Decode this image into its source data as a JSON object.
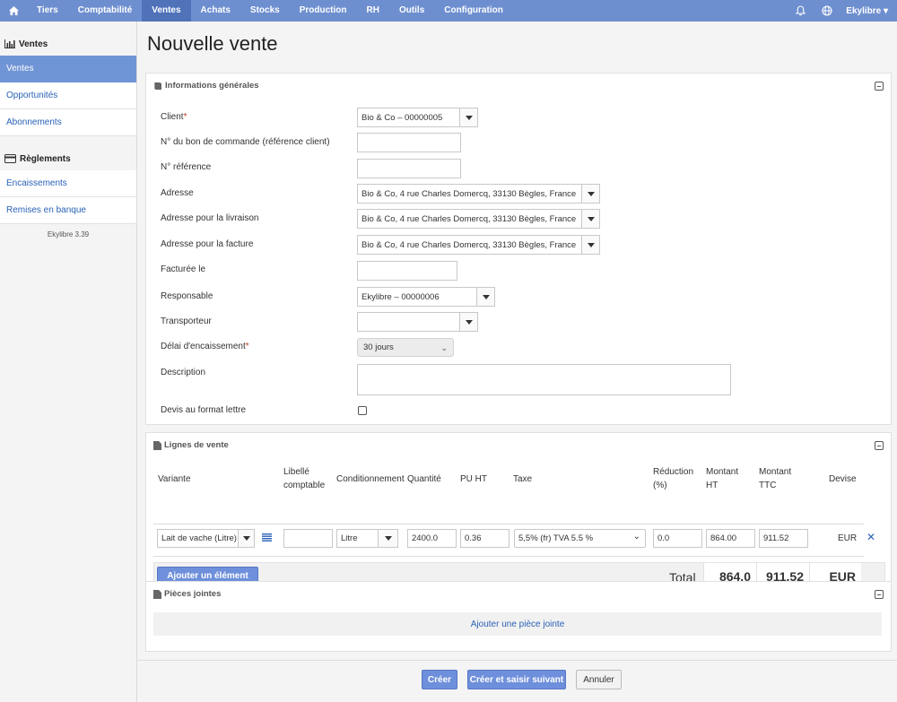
{
  "nav": {
    "items": [
      "Tiers",
      "Comptabilité",
      "Ventes",
      "Achats",
      "Stocks",
      "Production",
      "RH",
      "Outils",
      "Configuration"
    ],
    "active": "Ventes",
    "user": "Ekylibre ▾",
    "icons": [
      "home-icon",
      "bell-icon",
      "globe-icon"
    ]
  },
  "sidebar": {
    "sections": [
      {
        "title": "Ventes",
        "icon": "bar-chart-icon",
        "items": [
          "Ventes",
          "Opportunités",
          "Abonnements"
        ]
      },
      {
        "title": "Règlements",
        "icon": "credit-card-icon",
        "items": [
          "Encaissements",
          "Remises en banque"
        ]
      }
    ],
    "active": "Ventes",
    "version": "Ekylibre 3.39"
  },
  "page": {
    "title": "Nouvelle vente"
  },
  "general": {
    "title": "Informations générales",
    "fields": {
      "client": {
        "label": "Client",
        "value": "Bio & Co – 00000005"
      },
      "po": {
        "label": "N° du bon de commande (référence client)",
        "value": ""
      },
      "ref": {
        "label": "N° référence",
        "value": ""
      },
      "address": {
        "label": "Adresse",
        "value": "Bio & Co, 4 rue Charles Domercq, 33130 Bègles, France"
      },
      "delivery": {
        "label": "Adresse pour la livraison",
        "value": "Bio & Co, 4 rue Charles Domercq, 33130 Bègles, France"
      },
      "invoice_addr": {
        "label": "Adresse pour la facture",
        "value": "Bio & Co, 4 rue Charles Domercq, 33130 Bègles, France"
      },
      "invoiced_at": {
        "label": "Facturée le",
        "value": ""
      },
      "responsible": {
        "label": "Responsable",
        "value": "Ekylibre – 00000006"
      },
      "carrier": {
        "label": "Transporteur",
        "value": ""
      },
      "delay": {
        "label": "Délai d'encaissement",
        "value": "30 jours"
      },
      "description": {
        "label": "Description",
        "value": ""
      },
      "letter": {
        "label": "Devis au format lettre",
        "checked": false
      }
    }
  },
  "lines": {
    "title": "Lignes de vente",
    "headers": {
      "variant": "Variante",
      "label1": "Libellé",
      "label2": "comptable",
      "packaging": "Conditionnement",
      "qty": "Quantité",
      "pu": "PU HT",
      "tax": "Taxe",
      "red1": "Réduction",
      "red2": "(%)",
      "ht1": "Montant",
      "ht2": "HT",
      "ttc1": "Montant",
      "ttc2": "TTC",
      "currency": "Devise"
    },
    "row": {
      "variant": "Lait de vache (Litre)",
      "label": "",
      "packaging": "Litre",
      "qty": "2400.0",
      "pu": "0.36",
      "tax": "5,5% (fr) TVA 5.5 %",
      "reduction": "0.0",
      "ht": "864.00",
      "ttc": "911.52",
      "currency": "EUR"
    },
    "add_button": "Ajouter un élément",
    "total_label": "Total",
    "total_ht": "864.0",
    "total_ttc": "911.52",
    "total_currency": "EUR"
  },
  "attachments": {
    "title": "Pièces jointes",
    "add": "Ajouter une pièce jointe"
  },
  "actions": {
    "create": "Créer",
    "create_next": "Créer et saisir suivant",
    "cancel": "Annuler"
  },
  "colors": {
    "nav": "#6e8fcf",
    "nav_active": "#4f72b9",
    "link": "#2a62b7",
    "button": "#6e8fdb"
  }
}
